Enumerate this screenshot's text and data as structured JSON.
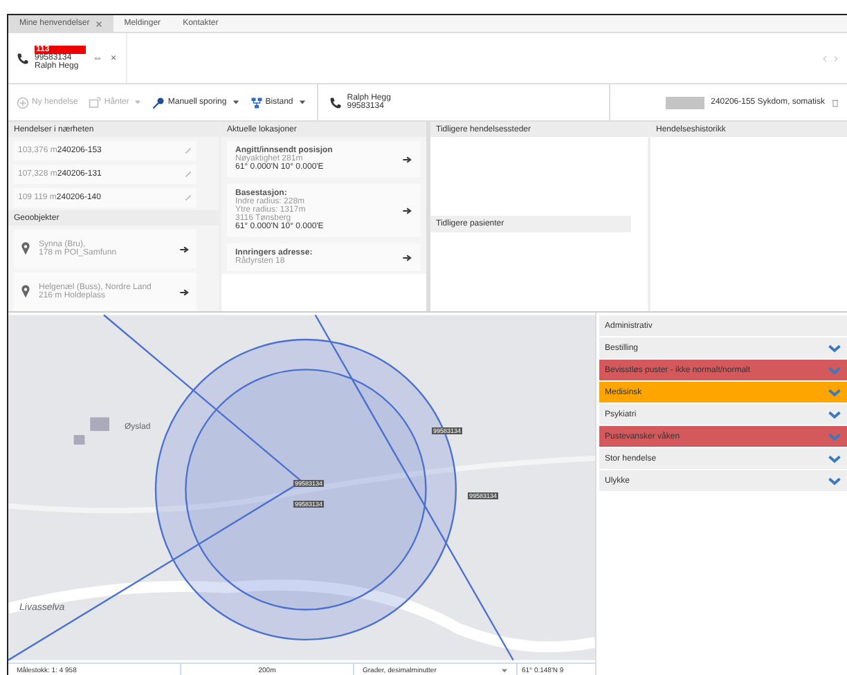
{
  "tabs": [
    {
      "label": "Mine henvendelser",
      "selected": true,
      "closable": true
    },
    {
      "label": "Meldinger",
      "selected": false,
      "closable": false
    },
    {
      "label": "Kontakter",
      "selected": false,
      "closable": false
    }
  ],
  "call": {
    "code": "113",
    "number": "99583134",
    "name": "Ralph Hegg",
    "pin": "⇔",
    "close": "×"
  },
  "toolbar": {
    "buttons": [
      {
        "label": "Ny hendelse",
        "disabled": true,
        "dropdown": false
      },
      {
        "label": "Hånter",
        "disabled": true,
        "dropdown": true
      },
      {
        "label": "Manuell sporing",
        "disabled": false,
        "dropdown": true
      },
      {
        "label": "Bistand",
        "disabled": false,
        "dropdown": true
      }
    ],
    "caller": {
      "name": "Ralph Hegg",
      "number": "99583134"
    },
    "incident": "240206-155 Sykdom, somatisk"
  },
  "nearby": {
    "title": "Hendelser i nærheten",
    "items": [
      {
        "distance": "103,376 m",
        "id": "240206-153"
      },
      {
        "distance": "107,328 m",
        "id": "240206-131"
      },
      {
        "distance": "109 119 m",
        "id": "240206-140"
      }
    ]
  },
  "geo": {
    "title": "Geoobjekter",
    "items": [
      {
        "name": "Synna (Bru),",
        "detail": "178 m POI_Samfunn"
      },
      {
        "name": "Helgenæl (Buss), Nordre Land",
        "detail": "216 m Holdeplass"
      }
    ]
  },
  "locations": {
    "title": "Aktuelle lokasjoner",
    "items": [
      {
        "title": "Angitt/innsendt posisjon",
        "lines": [
          "Nøyaktighet 281m"
        ],
        "coords": "61° 0.000'N 10° 0.000'E"
      },
      {
        "title": "Basestasjon:",
        "lines": [
          "Indre radius: 228m",
          "Ytre radius: 1317m",
          "3116 Tønsberg"
        ],
        "coords": "61° 0.000'N 10° 0.000'E"
      },
      {
        "title": "Innringers adresse:",
        "lines": [
          "Rådyrsten 18"
        ]
      }
    ]
  },
  "previous_places": {
    "title": "Tidligere hendelsessteder"
  },
  "previous_patients": {
    "title": "Tidligere pasienter"
  },
  "history": {
    "title": "Hendelseshistorikk"
  },
  "map": {
    "places": [
      "Øyslad",
      "Livasselva"
    ],
    "badges": [
      "99583134",
      "99583134",
      "99583134",
      "99583134"
    ]
  },
  "categories": [
    {
      "label": "Administrativ",
      "expandable": false,
      "color": "#eeeeee"
    },
    {
      "label": "Bestilling",
      "expandable": true,
      "color": "#eeeeee"
    },
    {
      "label": "Bevisstløs puster - ikke normalt/normalt",
      "expandable": true,
      "color": "#d3595d"
    },
    {
      "label": "Medisinsk",
      "expandable": true,
      "color": "#ffa500"
    },
    {
      "label": "Psykiatri",
      "expandable": true,
      "color": "#eeeeee"
    },
    {
      "label": "Pustevansker våken",
      "expandable": true,
      "color": "#d3595d"
    },
    {
      "label": "Stor hendelse",
      "expandable": true,
      "color": "#eeeeee"
    },
    {
      "label": "Ulykke",
      "expandable": true,
      "color": "#eeeeee"
    }
  ],
  "status": {
    "scale": "Målestokk: 1: 4 958",
    "scalebar": "200m",
    "format": "Grader, desimalminutter",
    "position": "61° 0.148'N 9"
  }
}
